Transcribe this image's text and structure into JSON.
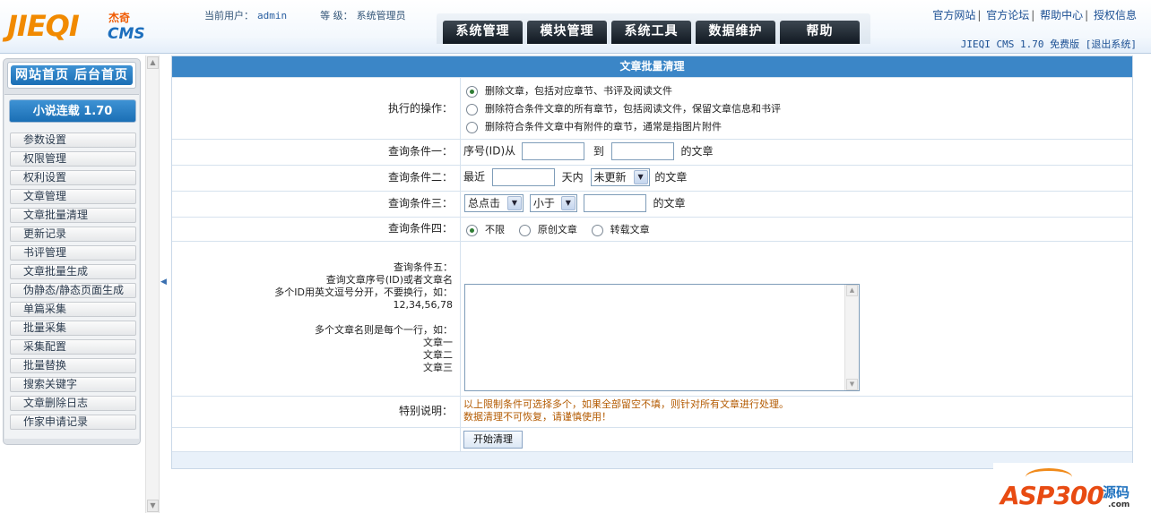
{
  "header": {
    "logo_main": "JIEQI",
    "logo_cn": "杰奇",
    "logo_cms": "CMS",
    "user_label": "当前用户：",
    "user_value": "admin",
    "level_label": "等  级：",
    "level_value": "系统管理员",
    "tabs": [
      "系统管理",
      "模块管理",
      "系统工具",
      "数据维护",
      "帮助"
    ],
    "links": [
      "官方网站",
      "官方论坛",
      "帮助中心",
      "授权信息"
    ],
    "version": "JIEQI CMS 1.70 免费版",
    "logout": "[退出系统]"
  },
  "sidebar": {
    "home": "网站首页",
    "admin_home": "后台首页",
    "module_title": "小说连载 1.70",
    "items": [
      "参数设置",
      "权限管理",
      "权利设置",
      "文章管理",
      "文章批量清理",
      "更新记录",
      "书评管理",
      "文章批量生成",
      "伪静态/静态页面生成",
      "单篇采集",
      "批量采集",
      "采集配置",
      "批量替换",
      "搜索关键字",
      "文章删除日志",
      "作家申请记录"
    ]
  },
  "form": {
    "title": "文章批量清理",
    "op_label": "执行的操作：",
    "op_options": [
      "删除文章，包括对应章节、书评及阅读文件",
      "删除符合条件文章的所有章节，包括阅读文件，保留文章信息和书评",
      "删除符合条件文章中有附件的章节，通常是指图片附件"
    ],
    "op_selected": 0,
    "c1_label": "查询条件一：",
    "c1_prefix": "序号(ID)从",
    "c1_to": "到",
    "c1_suffix": "的文章",
    "c2_label": "查询条件二：",
    "c2_prefix": "最近",
    "c2_mid": "天内",
    "c2_select": "未更新",
    "c2_suffix": "的文章",
    "c3_label": "查询条件三：",
    "c3_select1": "总点击",
    "c3_select2": "小于",
    "c3_suffix": "的文章",
    "c4_label": "查询条件四：",
    "c4_options": [
      "不限",
      "原创文章",
      "转载文章"
    ],
    "c4_selected": 0,
    "c5_lines": [
      "查询条件五：",
      "查询文章序号(ID)或者文章名",
      "多个ID用英文逗号分开，不要换行，如：",
      "12,34,56,78",
      "",
      "多个文章名则是每个一行，如：",
      "文章一",
      "文章二",
      "文章三"
    ],
    "note_label": "特别说明：",
    "note_lines": [
      "以上限制条件可选择多个，如果全部留空不填，则针对所有文章进行处理。",
      "数据清理不可恢复，请谨慎使用！"
    ],
    "submit": "开始清理"
  },
  "watermark": {
    "brand": "ASP300",
    "cn": "源码",
    "domain": ".com"
  }
}
